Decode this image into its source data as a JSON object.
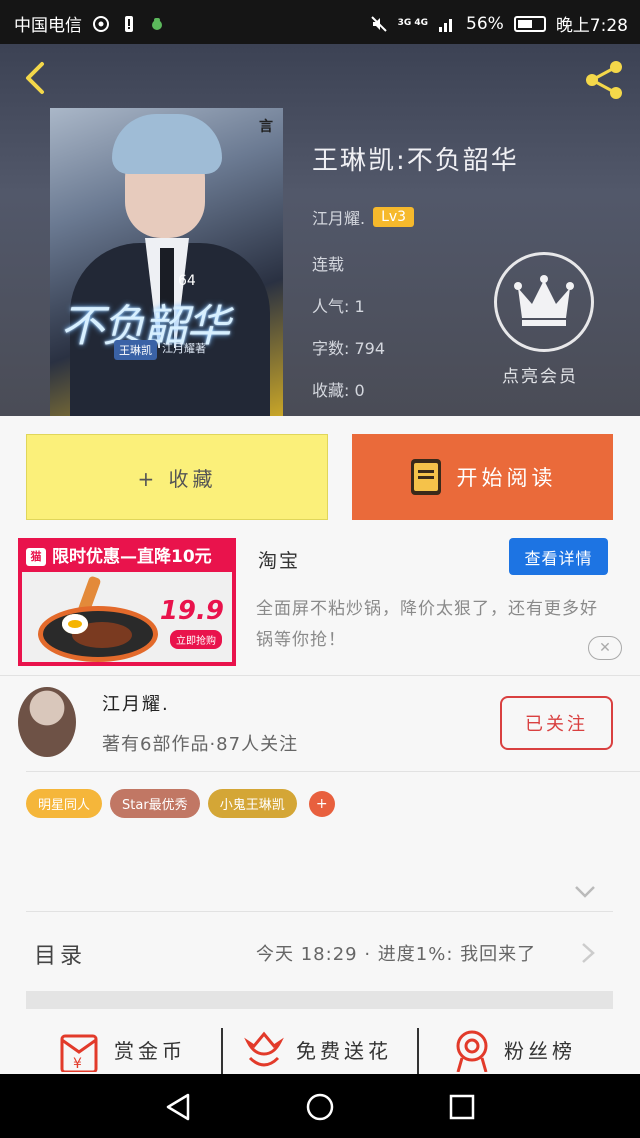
{
  "status_bar": {
    "carrier": "中国电信",
    "network": "3G 4G",
    "battery_pct": "56%",
    "time": "晚上7:28"
  },
  "book": {
    "title": "王琳凯:不负韶华",
    "author": "江月耀.",
    "level": "Lv3",
    "status": "连载",
    "popularity": "人气: 1",
    "word_count": "字数: 794",
    "favorites": "收藏: 0",
    "vip_label": "点亮会员"
  },
  "cover": {
    "number": "64",
    "title_art": "不负韶华",
    "name_tag": "王琳凯",
    "author_tag": "江月耀著"
  },
  "actions": {
    "collect": "+ 收藏",
    "read": "开始阅读"
  },
  "ad": {
    "banner": "限时优惠—直降10元",
    "tmall_logo": "猫",
    "price": "19.9",
    "buy_now": "立即抢购",
    "source": "淘宝",
    "button": "查看详情",
    "description": "全面屏不粘炒锅，降价太狠了，还有更多好锅等你抢！"
  },
  "author": {
    "name": "江月耀.",
    "meta": "著有6部作品·87人关注",
    "follow_label": "已关注"
  },
  "tags": [
    {
      "label": "明星同人",
      "color": "#f5b63a"
    },
    {
      "label": "Star最优秀",
      "color": "#c17764"
    },
    {
      "label": "小鬼王琳凯",
      "color": "#d4a636"
    }
  ],
  "toc": {
    "label": "目录",
    "latest": "今天 18:29 · 进度1%: 我回来了"
  },
  "bottom_actions": [
    {
      "label": "赏金币",
      "icon": "red-envelope-icon"
    },
    {
      "label": "免费送花",
      "icon": "flower-icon"
    },
    {
      "label": "粉丝榜",
      "icon": "medal-icon"
    }
  ],
  "colors": {
    "collect_bg": "#fbf07a",
    "read_bg": "#ea6a3a",
    "follow": "#d94040",
    "ad_button": "#1d74e3"
  }
}
